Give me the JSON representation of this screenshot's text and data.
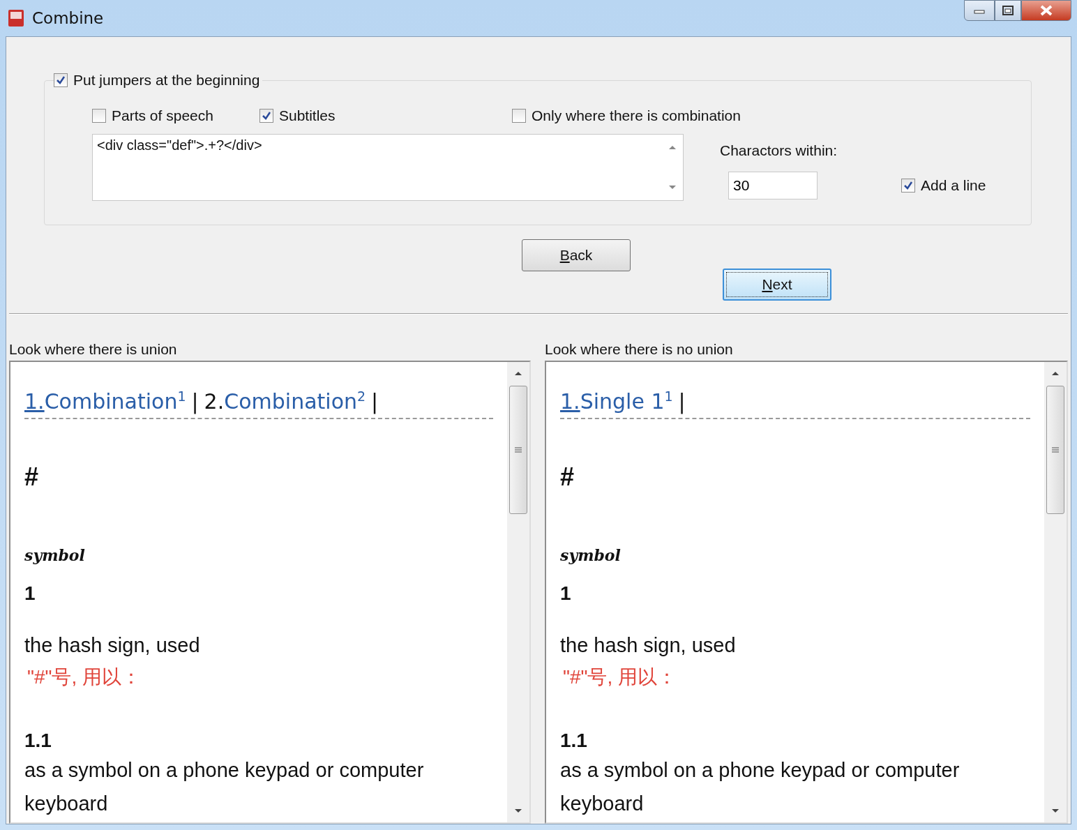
{
  "window": {
    "title": "Combine"
  },
  "options": {
    "jumpers": {
      "label": "Put jumpers at the beginning",
      "checked": true
    },
    "checkboxes": [
      {
        "label": "Parts of speech",
        "checked": false
      },
      {
        "label": "Subtitles",
        "checked": true
      },
      {
        "label": "Only where there is combination",
        "checked": false
      }
    ],
    "pattern": {
      "value": "<div class=\"def\">.+?</div>"
    },
    "characters_label": "Charactors within:",
    "characters": {
      "value": "30"
    },
    "add_line": {
      "label": "Add a line",
      "checked": true
    }
  },
  "buttons": [
    {
      "label": "Back",
      "default": false
    },
    {
      "label": "Next",
      "default": true
    }
  ],
  "panes": [
    {
      "label": "Look where there is union",
      "links": [
        {
          "number": "1.",
          "text": "Combination",
          "sup": "1",
          "current": true,
          "separator": "|"
        },
        {
          "number": "2.",
          "text": "Combination",
          "sup": "2",
          "current": false,
          "separator": "|"
        }
      ],
      "entry": {
        "headword": "#",
        "pos": "symbol",
        "sense": "1",
        "definition": "the hash sign, used",
        "translation": "\"#\"号, 用以：",
        "subsense": "1.1",
        "subdefinition": "as a symbol on a phone keypad or computer keyboard"
      }
    },
    {
      "label": "Look where there is no union",
      "links": [
        {
          "number": "1.",
          "text": "Single 1",
          "sup": "1",
          "current": true,
          "separator": "|"
        }
      ],
      "entry": {
        "headword": "#",
        "pos": "symbol",
        "sense": "1",
        "definition": "the hash sign, used",
        "translation": "\"#\"号, 用以：",
        "subsense": "1.1",
        "subdefinition": "as a symbol on a phone keypad or computer keyboard"
      }
    }
  ]
}
